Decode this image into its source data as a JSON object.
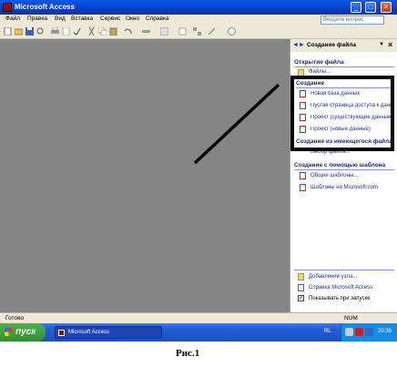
{
  "window": {
    "title": "Microsoft Access",
    "controls": {
      "minimize": "_",
      "maximize": "□",
      "close": "×"
    }
  },
  "menu": {
    "items": [
      "Файл",
      "Правка",
      "Вид",
      "Вставка",
      "Сервис",
      "Окно",
      "Справка"
    ],
    "help_placeholder": "Введите вопрос"
  },
  "task_pane": {
    "title": "Создание файла",
    "open_section": {
      "heading": "Открытие файла",
      "link": "Файлы..."
    },
    "create_section": {
      "heading": "Создание",
      "links": [
        "Новая база данных",
        "Пустая страница доступа к данным",
        "Проект (существующие данные)",
        "Проект (новые данные)"
      ]
    },
    "existing_section": {
      "heading": "Создание из имеющегося файла",
      "link": "Выбор файла..."
    },
    "template_section": {
      "heading": "Создание с помощью шаблона",
      "links": [
        "Общие шаблоны...",
        "Шаблоны на Microsoft.com"
      ]
    },
    "bottom_links": [
      "Добавление узла...",
      "Справка Microsoft Access"
    ],
    "startup_checkbox": {
      "label": "Показывать при запуске",
      "checked": true
    }
  },
  "status_bar": {
    "text": "Готово",
    "indicator": "NUM"
  },
  "taskbar": {
    "start_label": "пуск",
    "task": "Microsoft Access",
    "language": "RL",
    "clock": "20:36"
  },
  "caption": "Рис.1",
  "colors": {
    "title_bar": "#0a3fc8",
    "workspace": "#858585",
    "link": "#1a36b5",
    "section_heading": "#1b2e7a",
    "start_button": "#2f8f2f"
  }
}
